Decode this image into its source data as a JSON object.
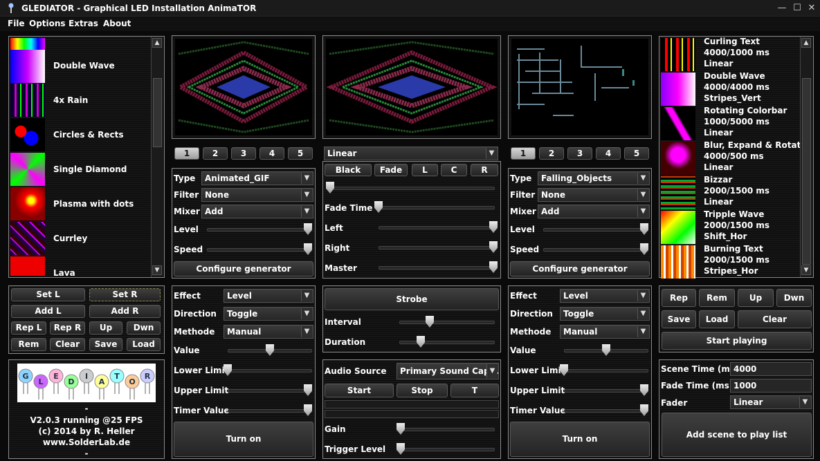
{
  "window": {
    "title": "GLEDIATOR - Graphical LED Installation AnimaTOR",
    "minimize": "—",
    "maximize": "☐",
    "close": "✕"
  },
  "menu": [
    "File",
    "Options",
    "Extras",
    "About"
  ],
  "generators": [
    {
      "name": "Double Wave"
    },
    {
      "name": "4x Rain"
    },
    {
      "name": "Circles & Rects"
    },
    {
      "name": "Single Diamond"
    },
    {
      "name": "Plasma with dots"
    },
    {
      "name": "Currley"
    },
    {
      "name": "Lava"
    }
  ],
  "left_buttons": {
    "set_l": "Set L",
    "set_r": "Set R",
    "add_l": "Add L",
    "add_r": "Add R",
    "rep_l": "Rep L",
    "rep_r": "Rep R",
    "up": "Up",
    "dwn": "Dwn",
    "rem": "Rem",
    "clear": "Clear",
    "save": "Save",
    "load": "Load"
  },
  "logo": {
    "letters": [
      "G",
      "L",
      "E",
      "D",
      "I",
      "A",
      "T",
      "O",
      "R"
    ],
    "dash1": "-",
    "version": "V2.0.3 running @25 FPS",
    "copyright": "(c) 2014 by R. Heller",
    "site": "www.SolderLab.de",
    "dash2": "-"
  },
  "tabs": [
    "1",
    "2",
    "3",
    "4",
    "5"
  ],
  "left_gen": {
    "type_label": "Type",
    "type_value": "Animated_GIF",
    "filter_label": "Filter",
    "filter_value": "None",
    "mixer_label": "Mixer",
    "mixer_value": "Add",
    "level_label": "Level",
    "level": 1.0,
    "speed_label": "Speed",
    "speed": 1.0,
    "configure": "Configure generator"
  },
  "right_gen": {
    "type_label": "Type",
    "type_value": "Falling_Objects",
    "filter_label": "Filter",
    "filter_value": "None",
    "mixer_label": "Mixer",
    "mixer_value": "Add",
    "level_label": "Level",
    "level": 1.0,
    "speed_label": "Speed",
    "speed": 1.0,
    "configure": "Configure generator"
  },
  "mixer": {
    "fade_mode": "Linear",
    "black": "Black",
    "fade": "Fade",
    "l": "L",
    "c": "C",
    "r": "R",
    "crossfade": 0.0,
    "fade_time_label": "Fade Time",
    "fade_time": 0.0,
    "left_label": "Left",
    "left": 1.0,
    "right_label": "Right",
    "right": 1.0,
    "master_label": "Master",
    "master": 1.0
  },
  "left_fx": {
    "effect_label": "Effect",
    "effect": "Level",
    "direction_label": "Direction",
    "direction": "Toggle",
    "methode_label": "Methode",
    "methode": "Manual",
    "value_label": "Value",
    "value": 0.5,
    "lower_label": "Lower Limit",
    "lower": 0.0,
    "upper_label": "Upper Limit",
    "upper": 1.0,
    "timer_label": "Timer Value",
    "timer": 1.0,
    "turn_on": "Turn on"
  },
  "right_fx": {
    "effect_label": "Effect",
    "effect": "Level",
    "direction_label": "Direction",
    "direction": "Toggle",
    "methode_label": "Methode",
    "methode": "Manual",
    "value_label": "Value",
    "value": 0.5,
    "lower_label": "Lower Limit",
    "lower": 0.0,
    "upper_label": "Upper Limit",
    "upper": 1.0,
    "timer_label": "Timer Value",
    "timer": 1.0,
    "turn_on": "Turn on"
  },
  "strobe": {
    "button": "Strobe",
    "interval_label": "Interval",
    "interval": 0.3,
    "duration_label": "Duration",
    "duration": 0.2
  },
  "audio": {
    "source_label": "Audio Source",
    "source": "Primary Sound Cap...",
    "start": "Start",
    "stop": "Stop",
    "t": "T",
    "gain_label": "Gain",
    "gain": 0.0,
    "trigger_label": "Trigger Level",
    "trigger": 0.0
  },
  "playlist": [
    {
      "name": "Curling Text",
      "time": "4000/1000 ms",
      "fader": "Linear"
    },
    {
      "name": "Double Wave",
      "time": "4000/4000 ms",
      "fader": "Stripes_Vert"
    },
    {
      "name": "Rotating Colorbar",
      "time": "1000/5000 ms",
      "fader": "Linear"
    },
    {
      "name": "Blur, Expand & Rotate",
      "time": "4000/500 ms",
      "fader": "Linear"
    },
    {
      "name": "Bizzar",
      "time": "2000/1500 ms",
      "fader": "Linear"
    },
    {
      "name": "Tripple Wave",
      "time": "2000/1500 ms",
      "fader": "Shift_Hor"
    },
    {
      "name": "Burning Text",
      "time": "2000/1500 ms",
      "fader": "Stripes_Hor"
    }
  ],
  "playlist_buttons": {
    "rep": "Rep",
    "rem": "Rem",
    "up": "Up",
    "dwn": "Dwn",
    "save": "Save",
    "load": "Load",
    "clear": "Clear",
    "start_playing": "Start playing"
  },
  "scene": {
    "scene_time_label": "Scene Time (ms)",
    "scene_time": "4000",
    "fade_time_label": "Fade Time (ms)",
    "fade_time": "1000",
    "fader_label": "Fader",
    "fader": "Linear",
    "add_scene": "Add scene to play list"
  }
}
